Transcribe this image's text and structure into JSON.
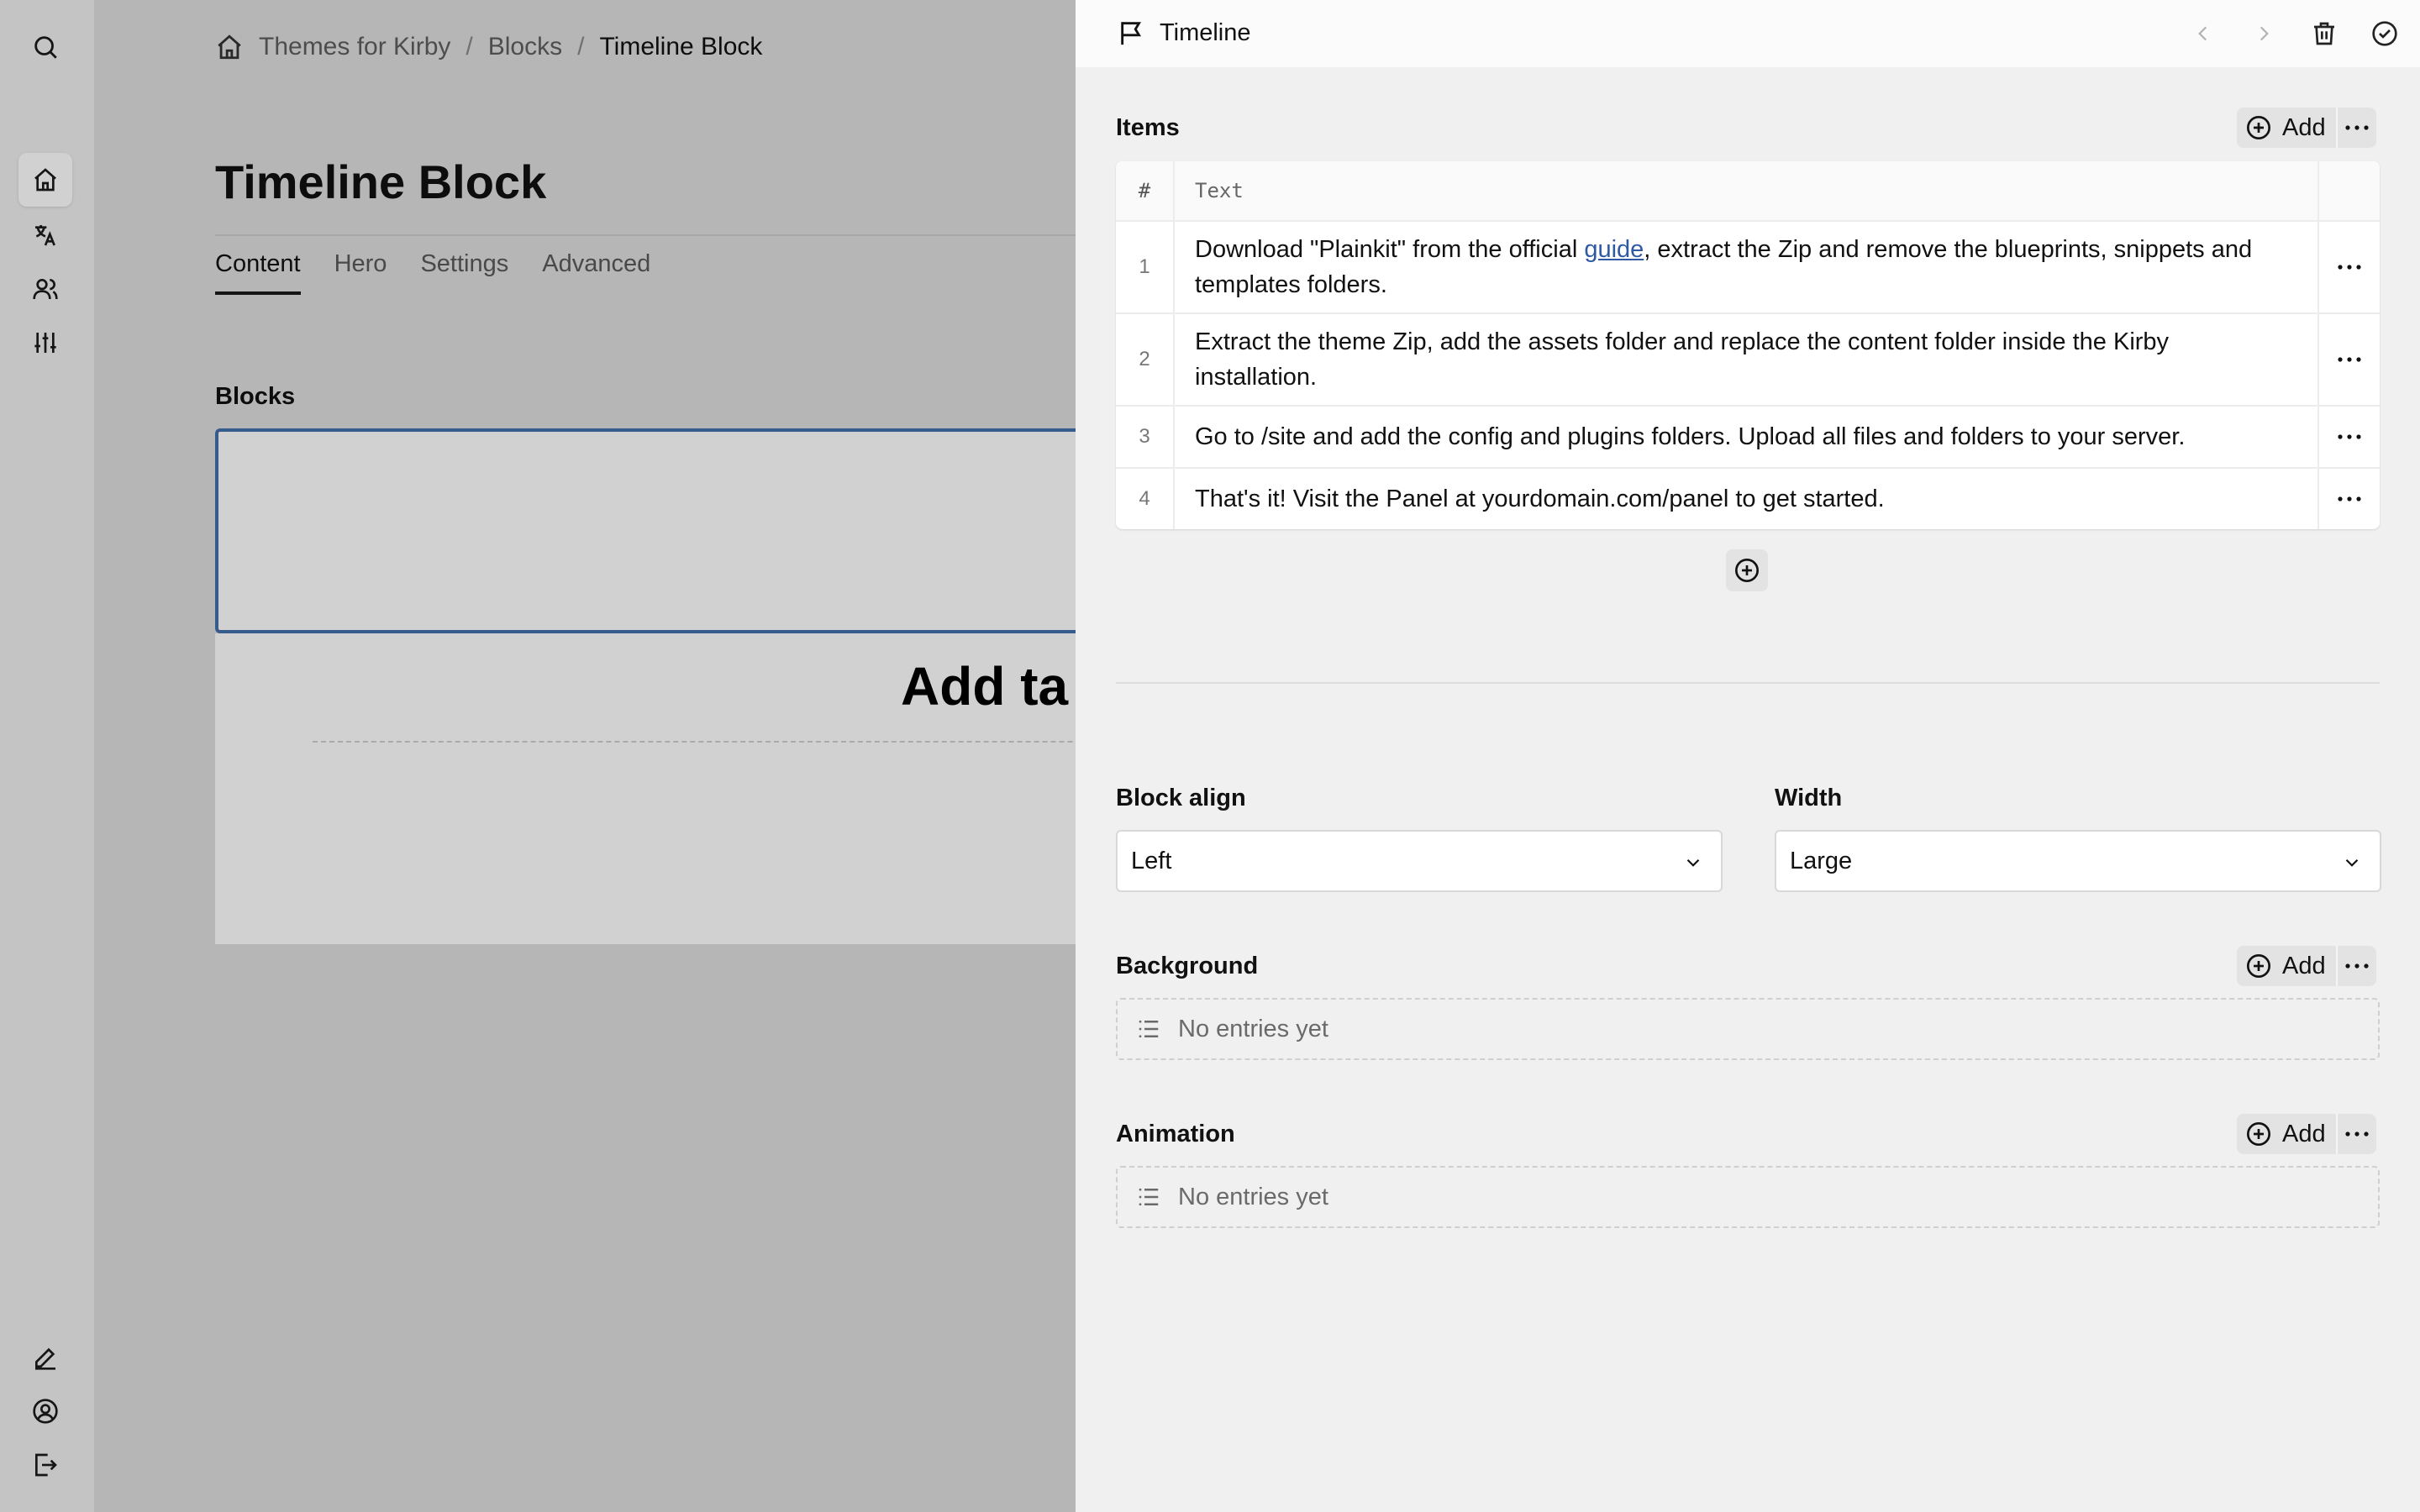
{
  "breadcrumb": {
    "site": "Themes for Kirby",
    "section": "Blocks",
    "current": "Timeline Block",
    "separator": "/"
  },
  "page": {
    "title": "Timeline Block",
    "tabs": [
      {
        "label": "Content",
        "active": true
      },
      {
        "label": "Hero",
        "active": false
      },
      {
        "label": "Settings",
        "active": false
      },
      {
        "label": "Advanced",
        "active": false
      }
    ],
    "blocks_label": "Blocks",
    "block_heading_visible": "Add ta"
  },
  "drawer": {
    "title": "Timeline",
    "items": {
      "label": "Items",
      "add_label": "Add",
      "columns": {
        "index": "#",
        "text": "Text"
      },
      "rows": [
        {
          "index": "1",
          "text_before": "Download \"Plainkit\" from the official ",
          "link": "guide",
          "text_after": ", extract the Zip and remove the blueprints, snippets and templates folders."
        },
        {
          "index": "2",
          "text": "Extract the theme Zip, add the assets folder and replace the content folder inside the Kirby installation."
        },
        {
          "index": "3",
          "text": "Go to /site and add the config and plugins folders. Upload all files and folders to your server."
        },
        {
          "index": "4",
          "text": "That's it! Visit the Panel at yourdomain.com/panel to get started."
        }
      ]
    },
    "block_align": {
      "label": "Block align",
      "value": "Left"
    },
    "width": {
      "label": "Width",
      "value": "Large"
    },
    "background": {
      "label": "Background",
      "add_label": "Add",
      "empty": "No entries yet"
    },
    "animation": {
      "label": "Animation",
      "add_label": "Add",
      "empty": "No entries yet"
    }
  },
  "icons": {
    "menu_top": [
      "search-icon",
      "home-icon",
      "translate-icon",
      "users-icon",
      "sliders-icon"
    ],
    "menu_bottom": [
      "pencil-icon",
      "account-icon",
      "logout-icon"
    ],
    "drawer_header": [
      "flag-icon",
      "chevron-left-icon",
      "chevron-right-icon",
      "trash-icon",
      "check-circle-icon"
    ]
  },
  "colors": {
    "focus_border": "#4271ae",
    "link": "#2f5aa3"
  }
}
